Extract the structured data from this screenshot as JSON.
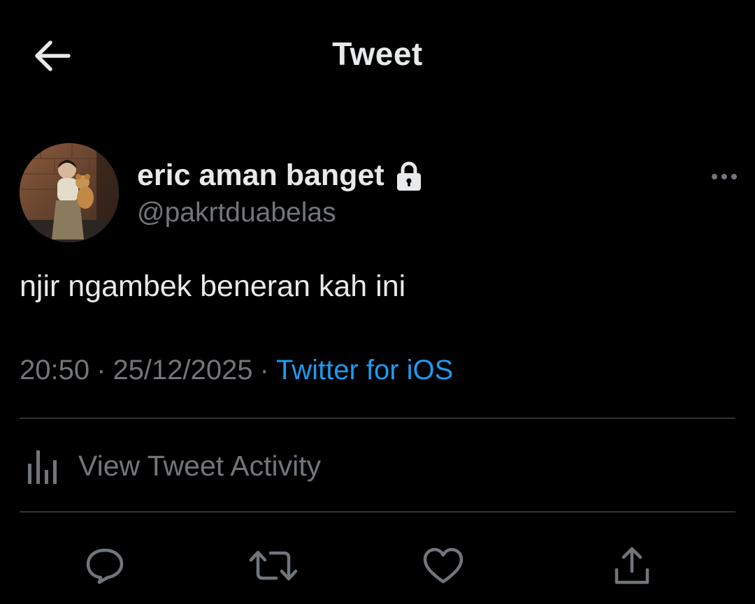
{
  "header": {
    "title": "Tweet",
    "back_icon": "arrow-left-icon"
  },
  "author": {
    "display_name": "eric aman banget",
    "handle": "@pakrtduabelas",
    "protected_icon": "lock-icon",
    "more_icon": "more-horizontal-icon"
  },
  "tweet": {
    "text": "njir ngambek beneran kah ini",
    "time": "20:50",
    "date": "25/12/2025",
    "separator": "·",
    "source": "Twitter for iOS"
  },
  "activity": {
    "label": "View Tweet Activity",
    "icon": "bar-chart-icon"
  },
  "actions": {
    "reply_icon": "reply-icon",
    "retweet_icon": "retweet-icon",
    "like_icon": "heart-icon",
    "share_icon": "share-icon"
  },
  "colors": {
    "background": "#000000",
    "text_primary": "#e7e9ea",
    "text_secondary": "#71767b",
    "accent": "#1d9bf0",
    "divider": "#2f3336"
  }
}
